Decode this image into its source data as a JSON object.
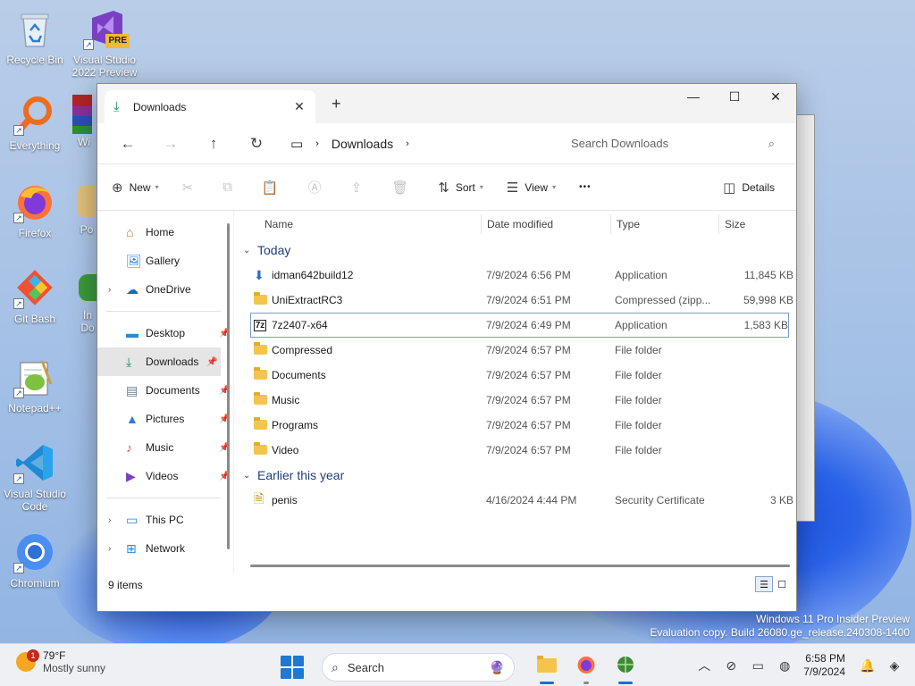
{
  "desktop": {
    "icons": [
      {
        "label": "Recycle Bin",
        "icon": "recycle-bin-icon"
      },
      {
        "label": "Visual Studio 2022 Preview",
        "icon": "visual-studio-preview-icon",
        "badge": "PRE"
      },
      {
        "label": "Everything",
        "icon": "everything-search-icon"
      },
      {
        "label": "Wi",
        "icon": "winrar-icon"
      },
      {
        "label": "Firefox",
        "icon": "firefox-icon"
      },
      {
        "label": "Po",
        "icon": "app-icon"
      },
      {
        "label": "Git Bash",
        "icon": "git-bash-icon"
      },
      {
        "label": "In Do",
        "icon": "app-icon"
      },
      {
        "label": "Notepad++",
        "icon": "notepad-plus-plus-icon"
      },
      {
        "label": "Visual Studio Code",
        "icon": "vscode-icon"
      },
      {
        "label": "Chromium",
        "icon": "chromium-icon"
      }
    ],
    "watermark_line1": "Windows 11 Pro Insider Preview",
    "watermark_line2": "Evaluation copy. Build 26080.ge_release.240308-1400"
  },
  "explorer": {
    "tab_title": "Downloads",
    "new_tab": "+",
    "window_controls": {
      "minimize": "—",
      "maximize": "☐",
      "close": "✕"
    },
    "breadcrumb": [
      "Downloads"
    ],
    "search_placeholder": "Search Downloads",
    "toolbar": {
      "new_label": "New",
      "sort_label": "Sort",
      "view_label": "View",
      "more_label": "•••",
      "details_label": "Details"
    },
    "sidebar": {
      "top": [
        {
          "label": "Home",
          "icon": "home-icon"
        },
        {
          "label": "Gallery",
          "icon": "gallery-icon"
        },
        {
          "label": "OneDrive",
          "icon": "onedrive-icon"
        }
      ],
      "pinned": [
        {
          "label": "Desktop",
          "icon": "desktop-icon"
        },
        {
          "label": "Downloads",
          "icon": "downloads-icon",
          "selected": true
        },
        {
          "label": "Documents",
          "icon": "documents-icon"
        },
        {
          "label": "Pictures",
          "icon": "pictures-icon"
        },
        {
          "label": "Music",
          "icon": "music-icon"
        },
        {
          "label": "Videos",
          "icon": "videos-icon"
        }
      ],
      "bottom": [
        {
          "label": "This PC",
          "icon": "this-pc-icon"
        },
        {
          "label": "Network",
          "icon": "network-icon"
        }
      ]
    },
    "columns": {
      "name": "Name",
      "date": "Date modified",
      "type": "Type",
      "size": "Size"
    },
    "groups": [
      {
        "label": "Today",
        "rows": [
          {
            "name": "idman642build12",
            "date": "7/9/2024 6:56 PM",
            "type": "Application",
            "size": "11,845 KB",
            "icon": "idm-installer-icon"
          },
          {
            "name": "UniExtractRC3",
            "date": "7/9/2024 6:51 PM",
            "type": "Compressed (zipp...",
            "size": "59,998 KB",
            "icon": "zip-folder-icon"
          },
          {
            "name": "7z2407-x64",
            "date": "7/9/2024 6:49 PM",
            "type": "Application",
            "size": "1,583 KB",
            "icon": "seven-zip-icon"
          },
          {
            "name": "Compressed",
            "date": "7/9/2024 6:57 PM",
            "type": "File folder",
            "size": "",
            "icon": "folder-icon"
          },
          {
            "name": "Documents",
            "date": "7/9/2024 6:57 PM",
            "type": "File folder",
            "size": "",
            "icon": "folder-icon"
          },
          {
            "name": "Music",
            "date": "7/9/2024 6:57 PM",
            "type": "File folder",
            "size": "",
            "icon": "folder-icon"
          },
          {
            "name": "Programs",
            "date": "7/9/2024 6:57 PM",
            "type": "File folder",
            "size": "",
            "icon": "folder-icon"
          },
          {
            "name": "Video",
            "date": "7/9/2024 6:57 PM",
            "type": "File folder",
            "size": "",
            "icon": "folder-icon"
          }
        ]
      },
      {
        "label": "Earlier this year",
        "rows": [
          {
            "name": "penis",
            "date": "4/16/2024 4:44 PM",
            "type": "Security Certificate",
            "size": "3 KB",
            "icon": "certificate-icon"
          }
        ]
      }
    ],
    "status": "9 items"
  },
  "taskbar": {
    "weather_temp": "79°F",
    "weather_desc": "Mostly sunny",
    "weather_badge": "1",
    "search_label": "Search",
    "clock_time": "6:58 PM",
    "clock_date": "7/9/2024"
  }
}
